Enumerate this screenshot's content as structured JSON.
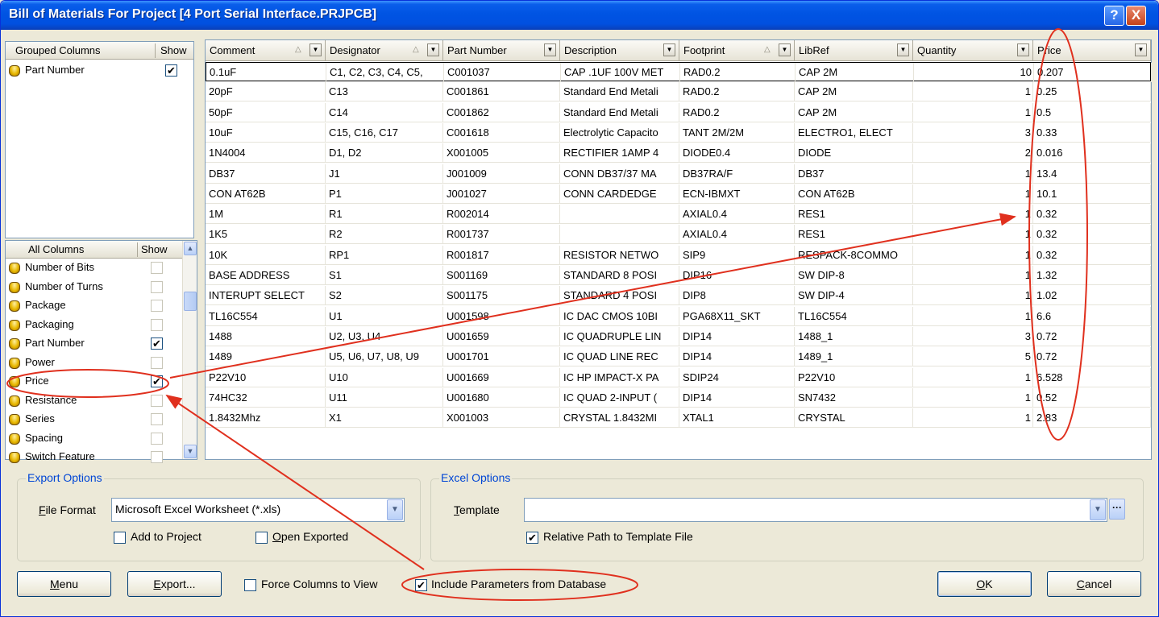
{
  "window": {
    "title": "Bill of Materials For Project [4 Port Serial Interface.PRJPCB]",
    "help_label": "?",
    "close_label": "X"
  },
  "grouped_columns": {
    "header": "Grouped Columns",
    "show_header": "Show",
    "items": [
      {
        "label": "Part Number",
        "checked": true
      }
    ]
  },
  "all_columns": {
    "header": "All Columns",
    "show_header": "Show",
    "items": [
      {
        "label": "Number of Bits",
        "checked": false
      },
      {
        "label": "Number of Turns",
        "checked": false
      },
      {
        "label": "Package",
        "checked": false
      },
      {
        "label": "Packaging",
        "checked": false
      },
      {
        "label": "Part Number",
        "checked": true
      },
      {
        "label": "Power",
        "checked": false
      },
      {
        "label": "Price",
        "checked": true
      },
      {
        "label": "Resistance",
        "checked": false
      },
      {
        "label": "Series",
        "checked": false
      },
      {
        "label": "Spacing",
        "checked": false
      },
      {
        "label": "Switch Feature",
        "checked": false
      }
    ]
  },
  "table": {
    "columns": [
      "Comment",
      "Designator",
      "Part Number",
      "Description",
      "Footprint",
      "LibRef",
      "Quantity",
      "Price"
    ],
    "rows": [
      [
        "0.1uF",
        "C1, C2, C3, C4, C5,",
        "C001037",
        "CAP .1UF 100V MET",
        "RAD0.2",
        "CAP 2M",
        "10",
        "0.207"
      ],
      [
        "20pF",
        "C13",
        "C001861",
        "Standard End Metali",
        "RAD0.2",
        "CAP 2M",
        "1",
        "0.25"
      ],
      [
        "50pF",
        "C14",
        "C001862",
        "Standard End Metali",
        "RAD0.2",
        "CAP 2M",
        "1",
        "0.5"
      ],
      [
        "10uF",
        "C15, C16, C17",
        "C001618",
        "Electrolytic Capacito",
        "TANT 2M/2M",
        "ELECTRO1, ELECT",
        "3",
        "0.33"
      ],
      [
        "1N4004",
        "D1, D2",
        "X001005",
        "RECTIFIER 1AMP 4",
        "DIODE0.4",
        "DIODE",
        "2",
        "0.016"
      ],
      [
        "DB37",
        "J1",
        "J001009",
        "CONN DB37/37 MA",
        "DB37RA/F",
        "DB37",
        "1",
        "13.4"
      ],
      [
        "CON AT62B",
        "P1",
        "J001027",
        "CONN CARDEDGE",
        "ECN-IBMXT",
        "CON AT62B",
        "1",
        "10.1"
      ],
      [
        "1M",
        "R1",
        "R002014",
        "",
        "AXIAL0.4",
        "RES1",
        "1",
        "0.32"
      ],
      [
        "1K5",
        "R2",
        "R001737",
        "",
        "AXIAL0.4",
        "RES1",
        "1",
        "0.32"
      ],
      [
        "10K",
        "RP1",
        "R001817",
        "RESISTOR NETWO",
        "SIP9",
        "RESPACK-8COMMO",
        "1",
        "0.32"
      ],
      [
        "BASE ADDRESS",
        "S1",
        "S001169",
        "STANDARD 8 POSI",
        "DIP16",
        "SW DIP-8",
        "1",
        "1.32"
      ],
      [
        "INTERUPT SELECT",
        "S2",
        "S001175",
        "STANDARD 4 POSI",
        "DIP8",
        "SW DIP-4",
        "1",
        "1.02"
      ],
      [
        "TL16C554",
        "U1",
        "U001598",
        "IC DAC CMOS 10BI",
        "PGA68X11_SKT",
        "TL16C554",
        "1",
        "6.6"
      ],
      [
        "1488",
        "U2, U3, U4",
        "U001659",
        "IC QUADRUPLE LIN",
        "DIP14",
        "1488_1",
        "3",
        "0.72"
      ],
      [
        "1489",
        "U5, U6, U7, U8, U9",
        "U001701",
        "IC QUAD LINE REC",
        "DIP14",
        "1489_1",
        "5",
        "0.72"
      ],
      [
        "P22V10",
        "U10",
        "U001669",
        "IC HP IMPACT-X PA",
        "SDIP24",
        "P22V10",
        "1",
        "6.528"
      ],
      [
        "74HC32",
        "U11",
        "U001680",
        "IC QUAD 2-INPUT (",
        "DIP14",
        "SN7432",
        "1",
        "0.52"
      ],
      [
        "1.8432Mhz",
        "X1",
        "X001003",
        "CRYSTAL 1.8432MI",
        "XTAL1",
        "CRYSTAL",
        "1",
        "2.83"
      ]
    ]
  },
  "export_options": {
    "legend": "Export Options",
    "file_format_label": "File Format",
    "file_format_value": "Microsoft Excel Worksheet (*.xls)",
    "add_to_project": {
      "label": "Add to Project",
      "checked": false
    },
    "open_exported": {
      "label": "Open Exported",
      "checked": false
    }
  },
  "excel_options": {
    "legend": "Excel Options",
    "template_label": "Template",
    "template_value": "",
    "relative_path": {
      "label": "Relative Path to Template File",
      "checked": true
    }
  },
  "footer": {
    "menu_label": "Menu",
    "export_label": "Export...",
    "force_columns": {
      "label": "Force Columns to View",
      "checked": false
    },
    "include_params": {
      "label": "Include Parameters from Database",
      "checked": true
    },
    "ok_label": "OK",
    "cancel_label": "Cancel"
  },
  "colors": {
    "title_bar": "#0054e3",
    "group_legend": "#0046d5",
    "annotation": "#e0301e"
  },
  "icons": [
    "database-icon",
    "checkbox-icon",
    "dropdown-arrow-icon",
    "sort-icon",
    "scroll-up-icon",
    "scroll-down-icon",
    "ellipsis-icon",
    "help-icon",
    "close-icon"
  ]
}
